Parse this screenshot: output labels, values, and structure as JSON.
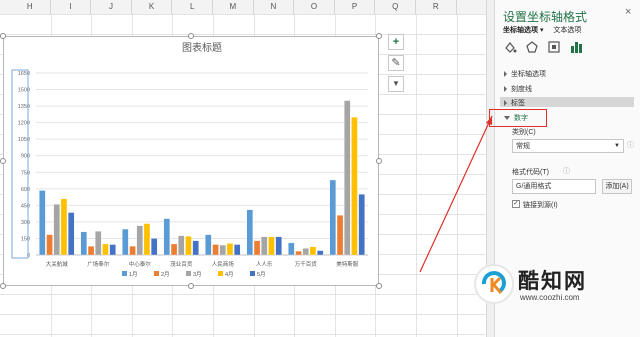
{
  "columns": [
    "H",
    "I",
    "J",
    "K",
    "L",
    "M",
    "N",
    "O",
    "P",
    "Q",
    "R"
  ],
  "chart_buttons": {
    "add": "+",
    "style": "✎",
    "filter": "▼"
  },
  "pane": {
    "title": "设置坐标轴格式",
    "close": "×",
    "tab_axis_options": "坐标轴选项 ▾",
    "tab_text_options": "文本选项",
    "sections": {
      "axis_options": "坐标轴选项",
      "tick_marks": "刻度线",
      "labels": "标签",
      "number": "数字"
    },
    "category_label": "类别(C)",
    "category_value": "常规",
    "format_code_label": "格式代码(T)",
    "format_code_value": "G/通用格式",
    "add_button": "添加(A)",
    "link_source_label": "链接到源(I)"
  },
  "watermark": {
    "brand": "酷知网",
    "url": "www.coozhi.com"
  },
  "colors": {
    "accent_green": "#217346",
    "annotation_red": "#e0302b",
    "s1": "#5b9bd5",
    "s2": "#ed7d31",
    "s3": "#a5a5a5",
    "s4": "#ffc000",
    "s5": "#4472c4"
  },
  "chart_data": {
    "type": "bar",
    "title": "图表标题",
    "categories": [
      "大关航城",
      "广场奉尔",
      "中心泰尔",
      "茂业百货",
      "人民商场",
      "人人乐",
      "万千百货",
      "美特斯服"
    ],
    "yticks": [
      0,
      150,
      300,
      450,
      600,
      750,
      900,
      1050,
      1200,
      1350,
      1500,
      1650
    ],
    "ylim": [
      0,
      1650
    ],
    "series": [
      {
        "name": "1月",
        "values": [
          585,
          210,
          235,
          330,
          185,
          410,
          110,
          680
        ]
      },
      {
        "name": "2月",
        "values": [
          185,
          80,
          80,
          100,
          95,
          130,
          35,
          360
        ]
      },
      {
        "name": "3月",
        "values": [
          460,
          215,
          265,
          175,
          90,
          165,
          60,
          1400
        ]
      },
      {
        "name": "4月",
        "values": [
          510,
          100,
          285,
          170,
          105,
          165,
          75,
          1250
        ]
      },
      {
        "name": "5月",
        "values": [
          385,
          95,
          150,
          130,
          95,
          165,
          40,
          550
        ]
      }
    ],
    "legend_position": "bottom",
    "grid": true
  }
}
